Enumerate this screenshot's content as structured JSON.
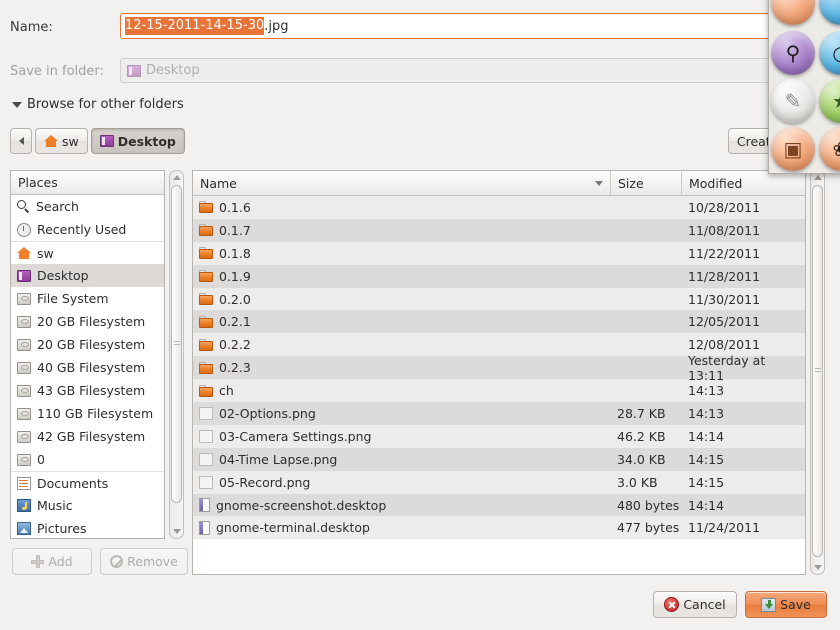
{
  "dialog": {
    "name_label": "Name:",
    "name_value_selected": "12-15-2011-14-15-30",
    "name_value_rest": ".jpg",
    "folder_label": "Save in folder:",
    "folder_value": "Desktop",
    "browse_label": "Browse for other folders",
    "create_folder_label": "Create Folder"
  },
  "breadcrumb": {
    "back_icon": "chevron-left-icon",
    "items": [
      {
        "label": "sw",
        "icon": "home-icon",
        "active": false
      },
      {
        "label": "Desktop",
        "icon": "desktop-icon",
        "active": true
      }
    ]
  },
  "places": {
    "header": "Places",
    "items": [
      {
        "label": "Search",
        "icon": "search-icon",
        "selected": false,
        "sep": false
      },
      {
        "label": "Recently Used",
        "icon": "recent-icon",
        "selected": false,
        "sep": false
      },
      {
        "label": "sw",
        "icon": "home-icon",
        "selected": false,
        "sep": true
      },
      {
        "label": "Desktop",
        "icon": "desktop-icon",
        "selected": true,
        "sep": false
      },
      {
        "label": "File System",
        "icon": "drive-icon",
        "selected": false,
        "sep": false
      },
      {
        "label": "20 GB Filesystem",
        "icon": "drive-icon",
        "selected": false,
        "sep": false
      },
      {
        "label": "20 GB Filesystem",
        "icon": "drive-icon",
        "selected": false,
        "sep": false
      },
      {
        "label": "40 GB Filesystem",
        "icon": "drive-icon",
        "selected": false,
        "sep": false
      },
      {
        "label": "43 GB Filesystem",
        "icon": "drive-icon",
        "selected": false,
        "sep": false
      },
      {
        "label": "110 GB Filesystem",
        "icon": "drive-icon",
        "selected": false,
        "sep": false
      },
      {
        "label": "42 GB Filesystem",
        "icon": "drive-icon",
        "selected": false,
        "sep": false
      },
      {
        "label": "0",
        "icon": "drive-icon",
        "selected": false,
        "sep": false
      },
      {
        "label": "Documents",
        "icon": "documents-icon",
        "selected": false,
        "sep": true
      },
      {
        "label": "Music",
        "icon": "music-icon",
        "selected": false,
        "sep": false
      },
      {
        "label": "Pictures",
        "icon": "pictures-icon",
        "selected": false,
        "sep": false
      }
    ],
    "add_label": "Add",
    "remove_label": "Remove"
  },
  "filelist": {
    "columns": [
      "Name",
      "Size",
      "Modified"
    ],
    "sorted_by": "Name",
    "rows": [
      {
        "name": "0.1.6",
        "icon": "folder-icon",
        "size": "",
        "modified": "10/28/2011"
      },
      {
        "name": "0.1.7",
        "icon": "folder-icon",
        "size": "",
        "modified": "11/08/2011"
      },
      {
        "name": "0.1.8",
        "icon": "folder-icon",
        "size": "",
        "modified": "11/22/2011"
      },
      {
        "name": "0.1.9",
        "icon": "folder-icon",
        "size": "",
        "modified": "11/28/2011"
      },
      {
        "name": "0.2.0",
        "icon": "folder-icon",
        "size": "",
        "modified": "11/30/2011"
      },
      {
        "name": "0.2.1",
        "icon": "folder-icon",
        "size": "",
        "modified": "12/05/2011"
      },
      {
        "name": "0.2.2",
        "icon": "folder-icon",
        "size": "",
        "modified": "12/08/2011"
      },
      {
        "name": "0.2.3",
        "icon": "folder-icon",
        "size": "",
        "modified": "Yesterday at 13:11"
      },
      {
        "name": "ch",
        "icon": "folder-icon",
        "size": "",
        "modified": "14:13"
      },
      {
        "name": "02-Options.png",
        "icon": "image-thumbnail-icon",
        "size": "28.7 KB",
        "modified": "14:13"
      },
      {
        "name": "03-Camera Settings.png",
        "icon": "image-thumbnail-icon",
        "size": "46.2 KB",
        "modified": "14:14"
      },
      {
        "name": "04-Time Lapse.png",
        "icon": "image-thumbnail-icon",
        "size": "34.0 KB",
        "modified": "14:15"
      },
      {
        "name": "05-Record.png",
        "icon": "image-thumbnail-icon",
        "size": "3.0 KB",
        "modified": "14:15"
      },
      {
        "name": "gnome-screenshot.desktop",
        "icon": "document-icon",
        "size": "480 bytes",
        "modified": "14:14"
      },
      {
        "name": "gnome-terminal.desktop",
        "icon": "document-icon",
        "size": "477 bytes",
        "modified": "11/24/2011"
      }
    ]
  },
  "actions": {
    "cancel_label": "Cancel",
    "save_label": "Save"
  },
  "palette": {
    "items": [
      {
        "icon": "zoom-in-icon",
        "color": "purple",
        "glyph": "⊕"
      },
      {
        "icon": "face-icon",
        "color": "blue",
        "glyph": "●"
      },
      {
        "icon": "signature-icon",
        "color": "gray",
        "glyph": "✎"
      },
      {
        "icon": "globe-icon",
        "color": "green",
        "glyph": "●"
      },
      {
        "icon": "camera-icon",
        "color": "peach",
        "glyph": "◎"
      },
      {
        "icon": "insect-icon",
        "color": "peach",
        "glyph": "❀"
      }
    ]
  },
  "colors": {
    "accent": "#e8743a",
    "window_bg": "#f2f1f0",
    "row_odd": "#eeecea",
    "row_even": "#dddbd9",
    "selection": "#dcd9d6"
  }
}
